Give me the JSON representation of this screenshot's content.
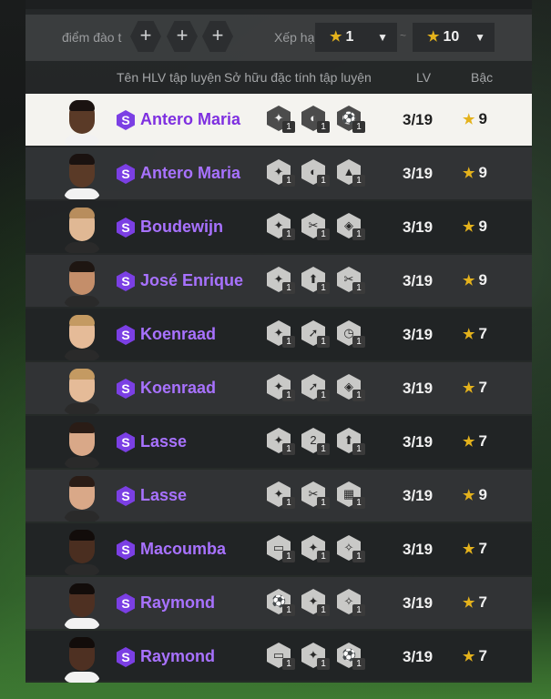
{
  "filters": {
    "training_points_label": "điểm đào tạ",
    "plus_buttons": [
      "+",
      "+",
      "+"
    ],
    "sort_label": "Xếp hạ",
    "range_min": "1",
    "range_separator": "~",
    "range_max": "10"
  },
  "columns": {
    "coach_name": "Tên HLV tập luyện",
    "traits": "Sở hữu đặc tính tập luyện",
    "level": "LV",
    "tier": "Bậc"
  },
  "colors": {
    "accent_purple": "#7b3fe4",
    "name_purple": "#a872ff",
    "star_gold": "#e4b21c",
    "selected_row": "#f4f3ef"
  },
  "rows": [
    {
      "badge": "S",
      "name": "Antero Maria",
      "skin": "#5a3a27",
      "hair": "#1a1210",
      "shirt": "#f2f2f2",
      "traits": [
        {
          "icon": "eagle-icon",
          "glyph": "✦",
          "level": "1"
        },
        {
          "icon": "whistle-icon",
          "glyph": "◐",
          "level": "1"
        },
        {
          "icon": "ball-icon",
          "glyph": "⚽",
          "level": "1"
        }
      ],
      "lv": "3/19",
      "tier": "9",
      "selected": true
    },
    {
      "badge": "S",
      "name": "Antero Maria",
      "skin": "#5a3a27",
      "hair": "#1a1210",
      "shirt": "#f2f2f2",
      "traits": [
        {
          "icon": "eagle-icon",
          "glyph": "✦",
          "level": "1"
        },
        {
          "icon": "whistle-icon",
          "glyph": "◐",
          "level": "1"
        },
        {
          "icon": "boot-icon",
          "glyph": "▲",
          "level": "1"
        }
      ],
      "lv": "3/19",
      "tier": "9"
    },
    {
      "badge": "S",
      "name": "Boudewijn",
      "skin": "#e0b894",
      "hair": "#b88d5d",
      "shirt": "#2a2a2a",
      "traits": [
        {
          "icon": "eagle-icon",
          "glyph": "✦",
          "level": "1"
        },
        {
          "icon": "scissors-icon",
          "glyph": "✂",
          "level": "1"
        },
        {
          "icon": "shield-icon",
          "glyph": "◈",
          "level": "1"
        }
      ],
      "lv": "3/19",
      "tier": "9"
    },
    {
      "badge": "S",
      "name": "José Enrique",
      "skin": "#c48e6a",
      "hair": "#1e1612",
      "shirt": "#2a2a2a",
      "traits": [
        {
          "icon": "eagle-icon",
          "glyph": "✦",
          "level": "1"
        },
        {
          "icon": "arrow-up-icon",
          "glyph": "⬆",
          "level": "1"
        },
        {
          "icon": "scissors-icon",
          "glyph": "✂",
          "level": "1"
        }
      ],
      "lv": "3/19",
      "tier": "9"
    },
    {
      "badge": "S",
      "name": "Koenraad",
      "skin": "#e5bb98",
      "hair": "#c49a62",
      "shirt": "#2a2a2a",
      "traits": [
        {
          "icon": "eagle-icon",
          "glyph": "✦",
          "level": "1"
        },
        {
          "icon": "run-icon",
          "glyph": "➚",
          "level": "1"
        },
        {
          "icon": "stopwatch-icon",
          "glyph": "◷",
          "level": "1"
        }
      ],
      "lv": "3/19",
      "tier": "7"
    },
    {
      "badge": "S",
      "name": "Koenraad",
      "skin": "#e5bb98",
      "hair": "#c49a62",
      "shirt": "#2a2a2a",
      "traits": [
        {
          "icon": "eagle-icon",
          "glyph": "✦",
          "level": "1"
        },
        {
          "icon": "run-icon",
          "glyph": "➚",
          "level": "1"
        },
        {
          "icon": "shield-icon",
          "glyph": "◈",
          "level": "1"
        }
      ],
      "lv": "3/19",
      "tier": "7"
    },
    {
      "badge": "S",
      "name": "Lasse",
      "skin": "#d9a888",
      "hair": "#2a1c16",
      "shirt": "#2a2a2a",
      "traits": [
        {
          "icon": "eagle-icon",
          "glyph": "✦",
          "level": "1"
        },
        {
          "icon": "number-two-icon",
          "glyph": "2",
          "level": "1"
        },
        {
          "icon": "arrow-up-icon",
          "glyph": "⬆",
          "level": "1"
        }
      ],
      "lv": "3/19",
      "tier": "7"
    },
    {
      "badge": "S",
      "name": "Lasse",
      "skin": "#d9a888",
      "hair": "#2a1c16",
      "shirt": "#2a2a2a",
      "traits": [
        {
          "icon": "eagle-icon",
          "glyph": "✦",
          "level": "1"
        },
        {
          "icon": "scissors-icon",
          "glyph": "✂",
          "level": "1"
        },
        {
          "icon": "striped-shield-icon",
          "glyph": "▦",
          "level": "1"
        }
      ],
      "lv": "3/19",
      "tier": "9"
    },
    {
      "badge": "S",
      "name": "Macoumba",
      "skin": "#4a2e20",
      "hair": "#120c0a",
      "shirt": "#2a2a2a",
      "traits": [
        {
          "icon": "goal-icon",
          "glyph": "▭",
          "level": "1"
        },
        {
          "icon": "eagle-icon",
          "glyph": "✦",
          "level": "1"
        },
        {
          "icon": "player-icon",
          "glyph": "✧",
          "level": "1"
        }
      ],
      "lv": "3/19",
      "tier": "7"
    },
    {
      "badge": "S",
      "name": "Raymond",
      "skin": "#4e3022",
      "hair": "#120c0a",
      "shirt": "#f2f2f2",
      "traits": [
        {
          "icon": "ball-icon",
          "glyph": "⚽",
          "level": "1"
        },
        {
          "icon": "eagle-icon",
          "glyph": "✦",
          "level": "1"
        },
        {
          "icon": "player-icon",
          "glyph": "✧",
          "level": "1"
        }
      ],
      "lv": "3/19",
      "tier": "7"
    },
    {
      "badge": "S",
      "name": "Raymond",
      "skin": "#4e3022",
      "hair": "#120c0a",
      "shirt": "#f2f2f2",
      "traits": [
        {
          "icon": "goal-icon",
          "glyph": "▭",
          "level": "1"
        },
        {
          "icon": "eagle-icon",
          "glyph": "✦",
          "level": "1"
        },
        {
          "icon": "ball-foot-icon",
          "glyph": "⚽",
          "level": "1"
        }
      ],
      "lv": "3/19",
      "tier": "7"
    }
  ]
}
